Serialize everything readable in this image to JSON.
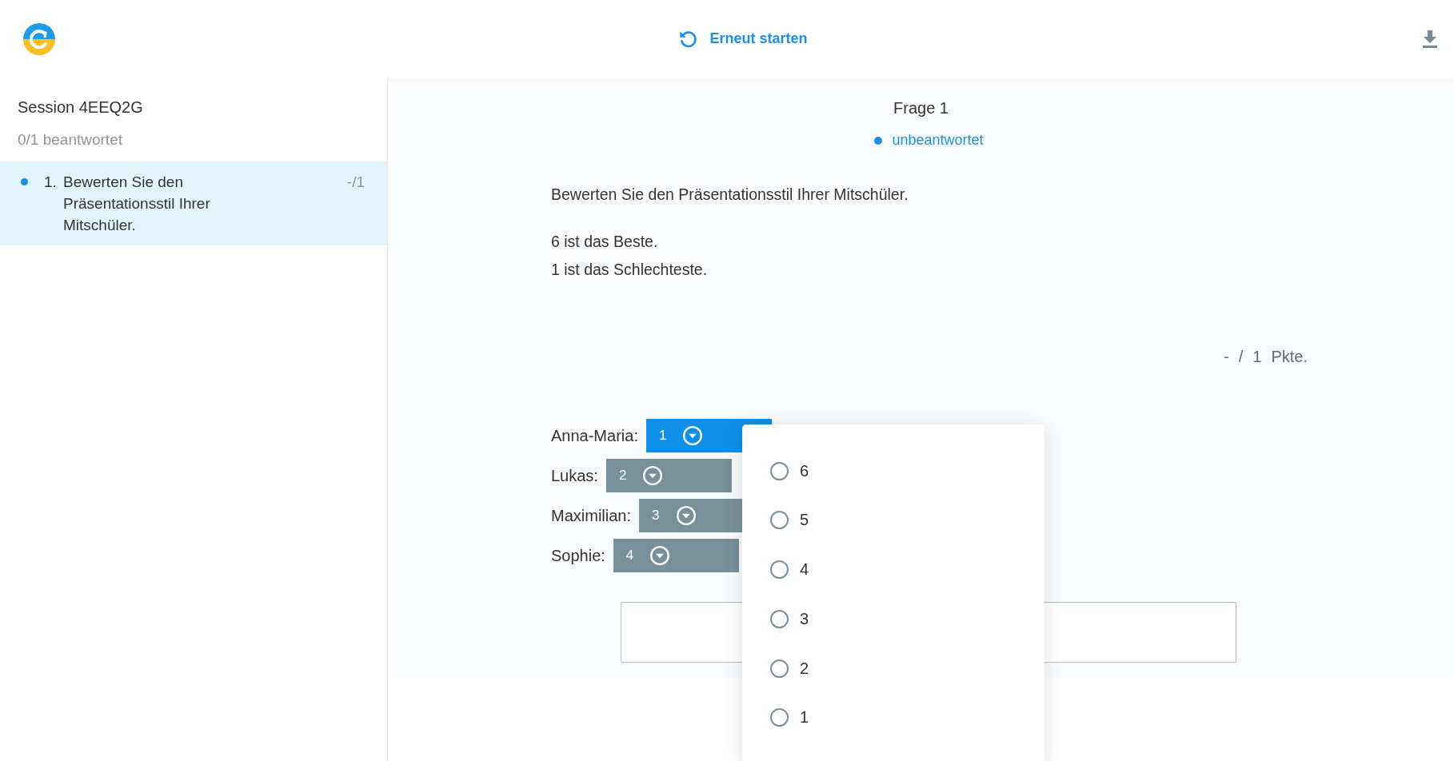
{
  "header": {
    "restart_label": "Erneut starten"
  },
  "sidebar": {
    "session": "Session 4EEQ2G",
    "progress": "0/1 beantwortet",
    "items": [
      {
        "number": "1.",
        "text": "Bewerten Sie den Präsentationsstil Ihrer Mitschüler.",
        "score": "-/1",
        "selected": true,
        "answered": false
      }
    ]
  },
  "question": {
    "title": "Frage 1",
    "status": "unbeantwortet",
    "answered": false,
    "text": "Bewerten Sie den Präsentationsstil Ihrer Mitschüler.",
    "notes": [
      "6 ist das Beste.",
      "1 ist das Schlechteste."
    ],
    "points": [
      "-",
      "/",
      "1",
      "Pkte."
    ],
    "ratings": [
      {
        "name": "Anna-Maria:",
        "value": "1",
        "selected": true
      },
      {
        "name": "Lukas:",
        "value": "2",
        "selected": false
      },
      {
        "name": "Maximilian:",
        "value": "3",
        "selected": false
      },
      {
        "name": "Sophie:",
        "value": "4",
        "selected": false
      }
    ]
  },
  "dropdown": {
    "options": [
      {
        "label": "6",
        "selected": false
      },
      {
        "label": "5",
        "selected": false
      },
      {
        "label": "4",
        "selected": false
      },
      {
        "label": "3",
        "selected": false
      },
      {
        "label": "2",
        "selected": false
      },
      {
        "label": "1",
        "selected": false
      }
    ]
  }
}
